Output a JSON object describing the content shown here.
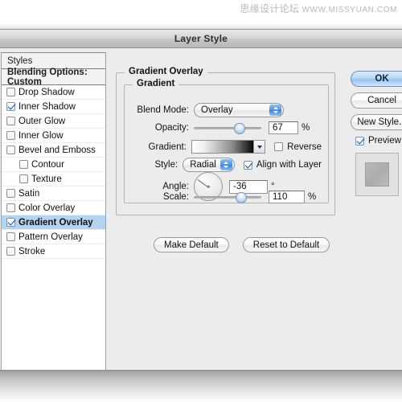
{
  "watermark": {
    "cn": "思缘设计论坛",
    "url": "WWW.MISSYUAN.COM"
  },
  "dialog": {
    "title": "Layer Style"
  },
  "styles_panel": {
    "header": "Styles",
    "blending_options": "Blending Options: Custom",
    "effects": [
      {
        "label": "Drop Shadow",
        "checked": false,
        "indented": false,
        "selected": false
      },
      {
        "label": "Inner Shadow",
        "checked": true,
        "indented": false,
        "selected": false
      },
      {
        "label": "Outer Glow",
        "checked": false,
        "indented": false,
        "selected": false
      },
      {
        "label": "Inner Glow",
        "checked": false,
        "indented": false,
        "selected": false
      },
      {
        "label": "Bevel and Emboss",
        "checked": false,
        "indented": false,
        "selected": false
      },
      {
        "label": "Contour",
        "checked": false,
        "indented": true,
        "selected": false
      },
      {
        "label": "Texture",
        "checked": false,
        "indented": true,
        "selected": false
      },
      {
        "label": "Satin",
        "checked": false,
        "indented": false,
        "selected": false
      },
      {
        "label": "Color Overlay",
        "checked": false,
        "indented": false,
        "selected": false
      },
      {
        "label": "Gradient Overlay",
        "checked": true,
        "indented": false,
        "selected": true
      },
      {
        "label": "Pattern Overlay",
        "checked": false,
        "indented": false,
        "selected": false
      },
      {
        "label": "Stroke",
        "checked": false,
        "indented": false,
        "selected": false
      }
    ]
  },
  "main": {
    "group_title": "Gradient Overlay",
    "subgroup_title": "Gradient",
    "blend_mode": {
      "label": "Blend Mode:",
      "value": "Overlay"
    },
    "opacity": {
      "label": "Opacity:",
      "value": "67",
      "unit": "%",
      "percent": 67
    },
    "gradient": {
      "label": "Gradient:",
      "reverse_label": "Reverse",
      "reverse_checked": false,
      "from_color": "#ffffff",
      "to_color": "#000000"
    },
    "style": {
      "label": "Style:",
      "value": "Radial",
      "align_label": "Align with Layer",
      "align_checked": true
    },
    "angle": {
      "label": "Angle:",
      "value": "-36",
      "unit": "°",
      "degrees": -36
    },
    "scale": {
      "label": "Scale:",
      "value": "110",
      "unit": "%",
      "percent": 69
    },
    "make_default": "Make Default",
    "reset_to_default": "Reset to Default"
  },
  "right": {
    "ok": "OK",
    "cancel": "Cancel",
    "new_style": "New Style...",
    "preview_label": "Preview",
    "preview_checked": true
  }
}
